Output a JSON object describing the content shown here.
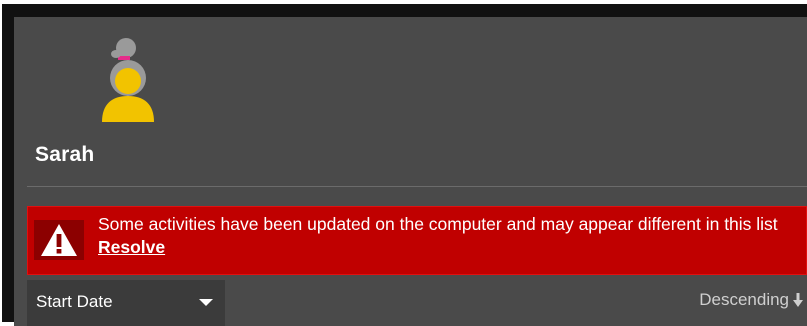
{
  "profile": {
    "name": "Sarah",
    "avatar_icon": "girl-avatar-icon"
  },
  "alert": {
    "icon": "warning-icon",
    "message": "Some activities have been updated on the computer and may appear different in this list",
    "link_label": "Resolve",
    "background": "#c00000"
  },
  "sort": {
    "field_selected": "Start Date",
    "order_label": "Descending",
    "order_icon": "arrow-down-icon"
  }
}
